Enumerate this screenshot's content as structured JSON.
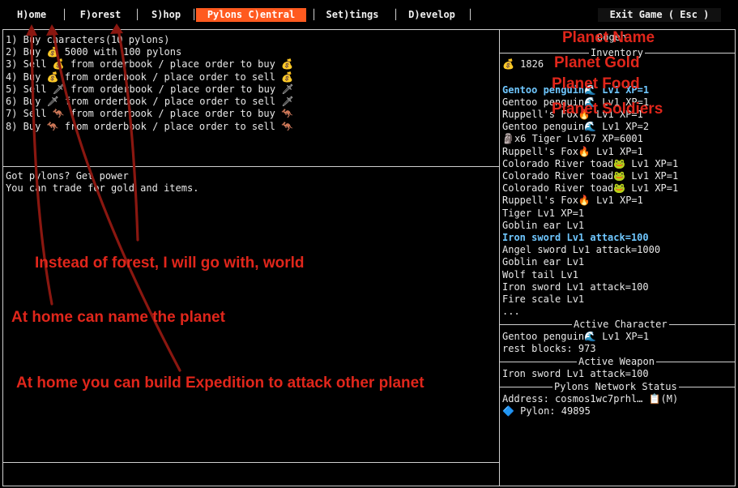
{
  "menu": {
    "items": [
      {
        "label": "H)ome"
      },
      {
        "label": "F)orest"
      },
      {
        "label": "S)hop"
      },
      {
        "label": "Pylons C)entral",
        "active": true
      },
      {
        "label": "Set)tings"
      },
      {
        "label": "D)evelop"
      }
    ],
    "exit_label": "Exit Game ( Esc )"
  },
  "main": {
    "options": [
      "1) Buy characters(10 pylons)",
      "2) Buy 💰 5000 with 100 pylons",
      "3) Sell 💰 from orderbook / place order to buy 💰",
      "4) Buy 💰 from orderbook / place order to sell 💰",
      "5) Sell 🗡 from orderbook / place order to buy 🗡",
      "6) Buy 🗡 from orderbook / place order to sell 🗡",
      "7) Sell 🦘 from orderbook / place order to buy 🦘",
      "8) Buy 🦘 from orderbook / place order to sell 🦘"
    ],
    "message": [
      "Got pylons? Get power",
      "You can trade for gold and items."
    ]
  },
  "side": {
    "player_name": "Oogen",
    "inventory_title": "Inventory",
    "gold": "💰 1826",
    "items": [
      {
        "text": "Gentoo penguin🌊 Lv1 XP=1",
        "hl": true
      },
      {
        "text": "Gentoo penguin🌊 Lv1 XP=1"
      },
      {
        "text": "Ruppell's Fox🔥 Lv1 XP=1"
      },
      {
        "text": "Gentoo penguin🌊 Lv1 XP=2"
      },
      {
        "text": "🗿x6 Tiger Lv167 XP=6001"
      },
      {
        "text": "Ruppell's Fox🔥 Lv1 XP=1"
      },
      {
        "text": "Colorado River toad🐸 Lv1 XP=1"
      },
      {
        "text": "Colorado River toad🐸 Lv1 XP=1"
      },
      {
        "text": "Colorado River toad🐸 Lv1 XP=1"
      },
      {
        "text": "Ruppell's Fox🔥 Lv1 XP=1"
      },
      {
        "text": "Tiger Lv1 XP=1"
      },
      {
        "text": "Goblin ear Lv1"
      },
      {
        "text": "Iron sword Lv1 attack=100",
        "hl": true
      },
      {
        "text": "Angel sword Lv1 attack=1000"
      },
      {
        "text": "Goblin ear Lv1"
      },
      {
        "text": "Wolf tail Lv1"
      },
      {
        "text": "Iron sword Lv1 attack=100"
      },
      {
        "text": "Fire scale Lv1"
      },
      {
        "text": "..."
      }
    ],
    "active_character_title": "Active Character",
    "active_character": "Gentoo penguin🌊 Lv1 XP=1",
    "rest_blocks": "rest blocks: 973",
    "active_weapon_title": "Active Weapon",
    "active_weapon": "Iron sword Lv1 attack=100",
    "network_title": "Pylons Network Status",
    "address": "Address: cosmos1wc7prhl… 📋(M)",
    "pylon": "🔷 Pylon: 49895"
  },
  "annotations": {
    "planet_name": "Planet Name",
    "planet_gold": "Planet Gold",
    "planet_food": "Planet Food",
    "planet_soldiers": "Planet Soldiers",
    "forest_note": "Instead of forest, I will go with, world",
    "home_name_note": "At home can name the planet",
    "home_expedition_note": "At home you can build Expedition to attack other planet"
  },
  "colors": {
    "active_tab": "#ff5a1f",
    "annotation": "#e0261b",
    "highlight": "#6fc7ff"
  }
}
